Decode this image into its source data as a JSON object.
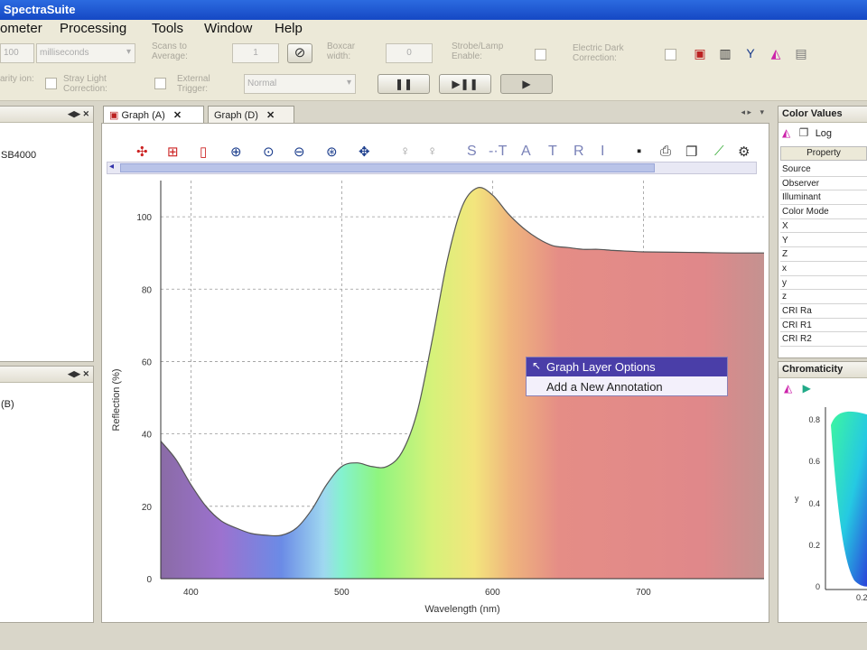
{
  "window": {
    "title": "SpectraSuite"
  },
  "menu": [
    "ometer",
    "Processing",
    "Tools",
    "Window",
    "Help"
  ],
  "toolbar": {
    "integration_value": "100",
    "integration_unit": "milliseconds",
    "scans_label": "Scans to Average:",
    "scans_value": "1",
    "boxcar_label": "Boxcar width:",
    "boxcar_value": "0",
    "strobe_label": "Strobe/Lamp Enable:",
    "electric_dark_label": "Electric Dark Correction:",
    "nonlinearity_label": "arity ion:",
    "stray_light_label": "Stray Light Correction:",
    "external_trigger_label": "External Trigger:",
    "trigger_mode": "Normal",
    "pause_label": "❚❚",
    "step_label": "▶❚❚",
    "play_label": "▶"
  },
  "left_panel": {
    "top_item": "SB4000",
    "bottom_item": "(B)"
  },
  "tabs": [
    {
      "label": "Graph (A)",
      "active": true
    },
    {
      "label": "Graph (D)",
      "active": false
    }
  ],
  "graph_tools": [
    "S",
    "-·T",
    "A",
    "T",
    "R",
    "I"
  ],
  "graph": {
    "ylabel": "Reflection (%)",
    "xlabel": "Wavelength (nm)"
  },
  "context_menu": {
    "items": [
      "Graph Layer Options",
      "Add a New Annotation"
    ],
    "highlighted": 0
  },
  "color_values": {
    "title": "Color Values",
    "log_label": "Log",
    "property_header": "Property",
    "rows": [
      "Source",
      "Observer",
      "Illuminant",
      "Color Mode",
      "X",
      "Y",
      "Z",
      "x",
      "y",
      "z",
      "CRI Ra",
      "CRI R1",
      "CRI R2"
    ]
  },
  "chromaticity": {
    "title": "Chromaticity",
    "y_ticks": [
      "0.8",
      "0.6",
      "0.4",
      "0.2",
      "0"
    ],
    "ylabel": "y",
    "x_tick": "0.2"
  },
  "chart_data": {
    "type": "line",
    "xlabel": "Wavelength (nm)",
    "ylabel": "Reflection (%)",
    "xlim": [
      380,
      780
    ],
    "ylim": [
      0,
      110
    ],
    "x_ticks": [
      400,
      500,
      600,
      700
    ],
    "y_ticks": [
      0,
      20,
      40,
      60,
      80,
      100
    ],
    "grid": true,
    "series": [
      {
        "x": [
          380,
          390,
          400,
          410,
          420,
          430,
          440,
          450,
          460,
          470,
          480,
          490,
          500,
          510,
          520,
          530,
          540,
          550,
          560,
          570,
          580,
          590,
          600,
          610,
          620,
          630,
          640,
          650,
          660,
          670,
          680,
          690,
          700,
          720,
          740,
          760,
          780
        ],
        "values": [
          38,
          33,
          26,
          20,
          16,
          14,
          12.5,
          12,
          12,
          14,
          19,
          26,
          31,
          32,
          31,
          31,
          35,
          46,
          66,
          88,
          103,
          108,
          106,
          101,
          97,
          94,
          92,
          91.5,
          91,
          91,
          90.7,
          90.5,
          90.3,
          90.2,
          90.1,
          90,
          90
        ]
      }
    ]
  }
}
